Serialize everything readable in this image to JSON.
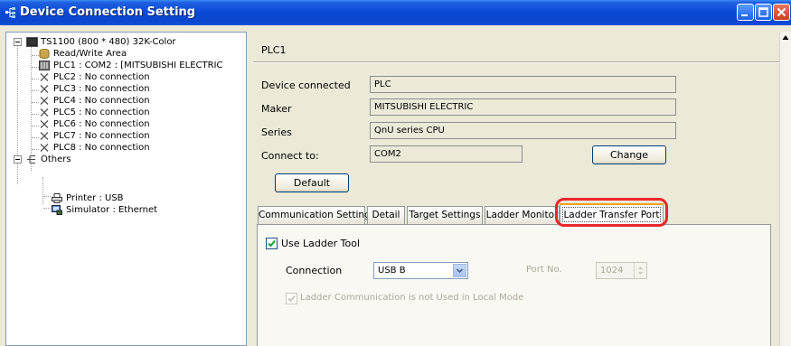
{
  "window": {
    "title": "Device Connection Setting",
    "colors": {
      "titlebar": "#0a49d6",
      "highlight": "#e8262a",
      "tab_accent": "#f5a316"
    }
  },
  "tree": {
    "root": "TS1100 (800 * 480) 32K-Color",
    "items": [
      {
        "label": "Read/Write Area",
        "icon": "database-icon"
      },
      {
        "label": "PLC1 : COM2 : [MITSUBISHI ELECTRIC",
        "icon": "plc-device-icon"
      },
      {
        "label": "PLC2 : No connection",
        "icon": "x-icon"
      },
      {
        "label": "PLC3 : No connection",
        "icon": "x-icon"
      },
      {
        "label": "PLC4 : No connection",
        "icon": "x-icon"
      },
      {
        "label": "PLC5 : No connection",
        "icon": "x-icon"
      },
      {
        "label": "PLC6 : No connection",
        "icon": "x-icon"
      },
      {
        "label": "PLC7 : No connection",
        "icon": "x-icon"
      },
      {
        "label": "PLC8 : No connection",
        "icon": "x-icon"
      }
    ],
    "others": {
      "label": "Others",
      "items": [
        {
          "label": "Printer : USB",
          "icon": "printer-icon"
        },
        {
          "label": "Simulator : Ethernet",
          "icon": "simulator-icon"
        }
      ]
    }
  },
  "detail": {
    "heading": "PLC1",
    "fields": [
      {
        "label": "Device connected",
        "value": "PLC"
      },
      {
        "label": "Maker",
        "value": "MITSUBISHI ELECTRIC"
      },
      {
        "label": "Series",
        "value": "QnU series CPU"
      },
      {
        "label": "Connect to:",
        "value": "COM2"
      }
    ],
    "change_button": "Change",
    "default_button": "Default"
  },
  "tabs": [
    {
      "label": "Communication Setting",
      "active": false
    },
    {
      "label": "Detail",
      "active": false
    },
    {
      "label": "Target Settings",
      "active": false
    },
    {
      "label": "Ladder Monitor",
      "active": false
    },
    {
      "label": "Ladder Transfer Port",
      "active": true
    }
  ],
  "ladder_port": {
    "use_ladder_tool": {
      "label": "Use Ladder Tool",
      "checked": true
    },
    "connection": {
      "label": "Connection",
      "value": "USB B"
    },
    "port_no": {
      "label": "Port No.",
      "value": "1024"
    },
    "local_mode": {
      "label": "Ladder Communication is not Used in Local Mode",
      "checked": true,
      "disabled": true
    }
  }
}
